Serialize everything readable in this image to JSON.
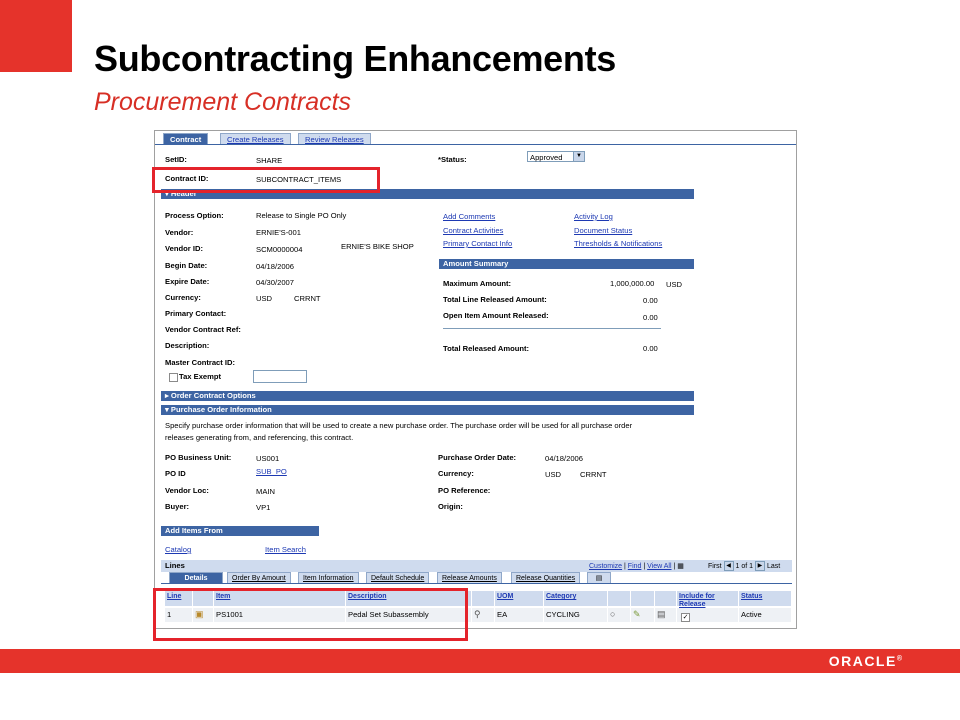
{
  "slide": {
    "title": "Subcontracting Enhancements",
    "subtitle": "Procurement Contracts",
    "brand": "ORACLE",
    "brand_mark": "®",
    "colors": {
      "accent_red": "#e5332b",
      "pia_blue": "#3d64a3",
      "link_blue": "#1d39b3"
    }
  },
  "tabs": [
    "Contract",
    "Create Releases",
    "Review Releases"
  ],
  "contract": {
    "setid_label": "SetID:",
    "setid_value": "SHARE",
    "contract_id_label": "Contract ID:",
    "contract_id_value": "SUBCONTRACT_ITEMS",
    "status_label": "*Status:",
    "status_value": "Approved"
  },
  "header": {
    "bar_label": "Header",
    "process_option_label": "Process Option:",
    "process_option_value": "Release to Single PO Only",
    "vendor_label": "Vendor:",
    "vendor_value": "ERNIE'S-001",
    "vendor_id_label": "Vendor ID:",
    "vendor_id_value": "SCM0000004",
    "vendor_name": "ERNIE'S BIKE SHOP",
    "begin_date_label": "Begin Date:",
    "begin_date_value": "04/18/2006",
    "expire_date_label": "Expire Date:",
    "expire_date_value": "04/30/2007",
    "currency_label": "Currency:",
    "currency_value": "USD",
    "currency_rate_type": "CRRNT",
    "primary_contact_label": "Primary Contact:",
    "vendor_contract_ref_label": "Vendor Contract Ref:",
    "description_label": "Description:",
    "master_contract_id_label": "Master Contract ID:",
    "tax_exempt_label": "Tax Exempt",
    "links": [
      "Add Comments",
      "Contract Activities",
      "Primary Contact Info",
      "Activity Log",
      "Document Status",
      "Thresholds & Notifications"
    ]
  },
  "amount_summary": {
    "bar_label": "Amount Summary",
    "max_amount_label": "Maximum Amount:",
    "max_amount_value": "1,000,000.00",
    "max_amount_currency": "USD",
    "total_line_released_label": "Total Line Released Amount:",
    "total_line_released_value": "0.00",
    "open_item_released_label": "Open Item Amount Released:",
    "open_item_released_value": "0.00",
    "total_released_label": "Total Released Amount:",
    "total_released_value": "0.00"
  },
  "order_contract_options": {
    "bar_label": "Order Contract Options"
  },
  "po_info": {
    "bar_label": "Purchase Order Information",
    "instructions_line1": "Specify purchase order information that will be used to create a new purchase order. The purchase order will be used for all purchase order",
    "instructions_line2": "releases generating from, and referencing, this contract.",
    "po_bu_label": "PO Business Unit:",
    "po_bu_value": "US001",
    "po_id_label": "PO ID",
    "po_id_value": "SUB_PO",
    "vendor_loc_label": "Vendor Loc:",
    "vendor_loc_value": "MAIN",
    "buyer_label": "Buyer:",
    "buyer_value": "VP1",
    "po_date_label": "Purchase Order Date:",
    "po_date_value": "04/18/2006",
    "currency_label": "Currency:",
    "currency_value": "USD",
    "currency_rate_type": "CRRNT",
    "po_reference_label": "PO Reference:",
    "origin_label": "Origin:"
  },
  "add_items": {
    "bar_label": "Add Items From",
    "catalog_link": "Catalog",
    "item_search_link": "Item Search"
  },
  "lines": {
    "title": "Lines",
    "customize": "Customize",
    "find": "Find",
    "view_all": "View All",
    "first": "First",
    "page_info": "1 of 1",
    "last": "Last",
    "tabs": [
      "Details",
      "Order By Amount",
      "Item Information",
      "Default Schedule",
      "Release Amounts",
      "Release Quantities"
    ],
    "columns": [
      "Line",
      "Item",
      "Description",
      "UOM",
      "Category",
      "Include for Release",
      "Status"
    ],
    "rows": [
      {
        "line": "1",
        "item": "PS1001",
        "description": "Pedal Set Subassembly",
        "uom": "EA",
        "category": "CYCLING",
        "include_for_release": true,
        "status": "Active"
      }
    ]
  }
}
